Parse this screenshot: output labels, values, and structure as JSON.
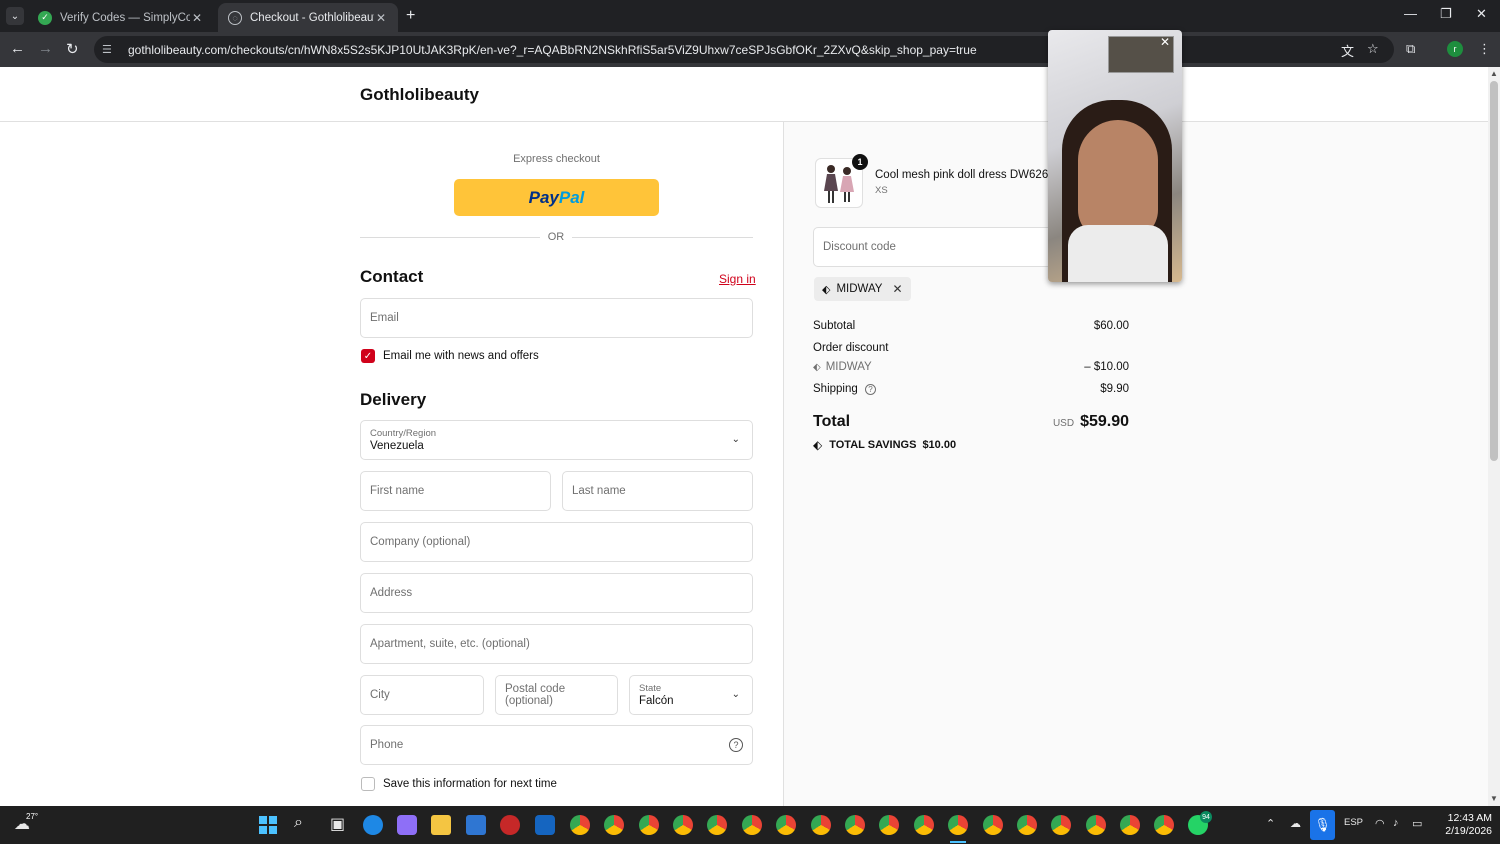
{
  "browser": {
    "tabs": [
      {
        "title": "Verify Codes — SimplyCodes",
        "active": false
      },
      {
        "title": "Checkout - Gothlolibeauty",
        "active": true
      }
    ],
    "url": "gothlolibeauty.com/checkouts/cn/hWN8x5S2s5KJP10UtJAK3RpK/en-ve?_r=AQABbRN2NSkhRfiS5ar5ViZ9Uhxw7ceSPJsGbfOKr_2ZXvQ&skip_shop_pay=true",
    "profile_initial": "r"
  },
  "shop": {
    "name": "Gothlolibeauty"
  },
  "checkout": {
    "express_label": "Express checkout",
    "paypal": {
      "part1": "Pay",
      "part2": "Pal"
    },
    "or_label": "OR",
    "contact": {
      "title": "Contact",
      "sign_in": "Sign in",
      "email_placeholder": "Email",
      "news_label": "Email me with news and offers",
      "news_checked": true
    },
    "delivery": {
      "title": "Delivery",
      "country_label": "Country/Region",
      "country_value": "Venezuela",
      "first_name": "First name",
      "last_name": "Last name",
      "company": "Company (optional)",
      "address": "Address",
      "apartment": "Apartment, suite, etc. (optional)",
      "city": "City",
      "postal": "Postal code (optional)",
      "state_label": "State",
      "state_value": "Falcón",
      "phone": "Phone",
      "save_label": "Save this information for next time",
      "save_checked": false
    }
  },
  "summary": {
    "product": {
      "name": "Cool mesh pink doll dress DW626",
      "variant": "XS",
      "quantity": "1"
    },
    "discount_placeholder": "Discount code",
    "applied_code": "MIDWAY",
    "subtotal_label": "Subtotal",
    "subtotal_value": "$60.00",
    "order_discount_label": "Order discount",
    "discount_code": "MIDWAY",
    "discount_value": "– $10.00",
    "shipping_label": "Shipping",
    "shipping_value": "$9.90",
    "total_label": "Total",
    "total_currency": "USD",
    "total_value": "$59.90",
    "savings_label": "TOTAL SAVINGS",
    "savings_value": "$10.00"
  },
  "taskbar": {
    "weather": "27°",
    "lang": "ESP",
    "time": "12:43 AM",
    "date": "2/19/2026",
    "whatsapp_badge": "94"
  },
  "colors": {
    "accent": "#d0021b",
    "paypal": "#ffc439"
  }
}
